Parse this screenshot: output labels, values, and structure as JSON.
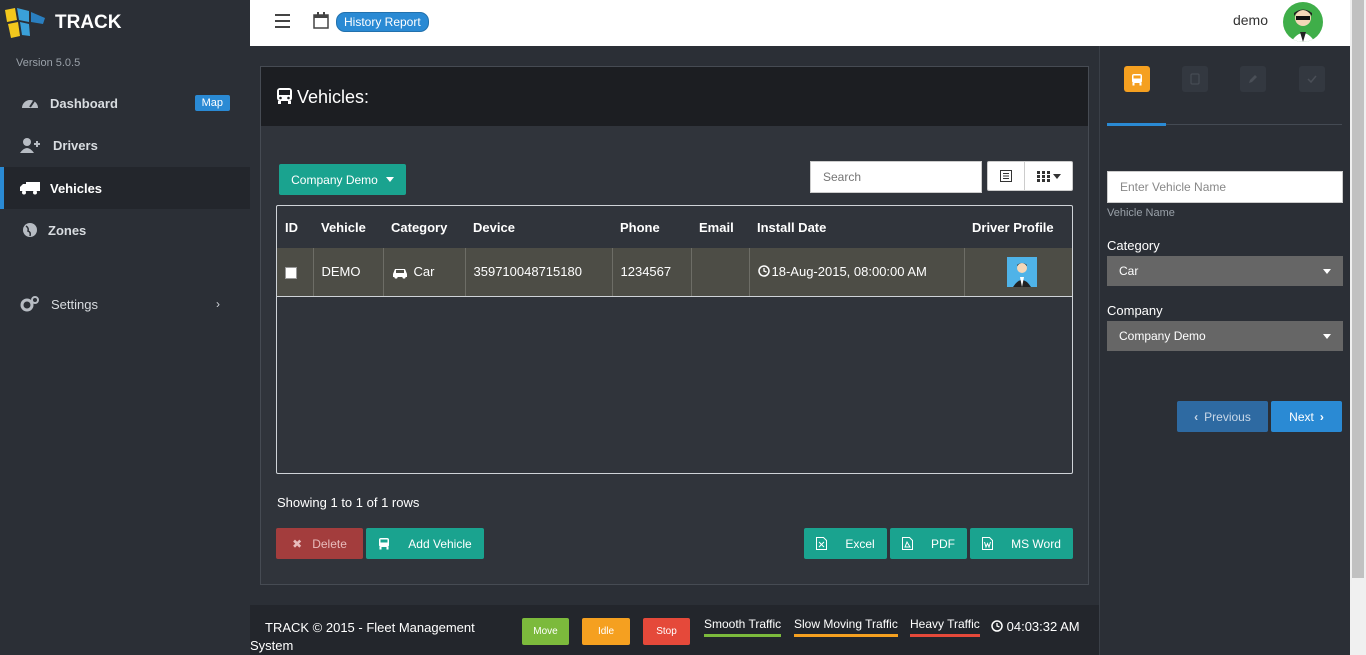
{
  "app": {
    "name": "TRACK",
    "version": "Version 5.0.5"
  },
  "sidebar": {
    "items": [
      {
        "label": "Dashboard",
        "icon": "dashboard-icon",
        "badge": "Map"
      },
      {
        "label": "Drivers",
        "icon": "add-user-icon"
      },
      {
        "label": "Vehicles",
        "icon": "truck-icon",
        "active": true
      },
      {
        "label": "Zones",
        "icon": "globe-icon"
      },
      {
        "label": "Settings",
        "icon": "gears-icon"
      }
    ]
  },
  "topbar": {
    "history_label": "History Report",
    "username": "demo"
  },
  "panel": {
    "title": "Vehicles:"
  },
  "toolbar": {
    "company_button": "Company Demo",
    "search_placeholder": "Search"
  },
  "table": {
    "headers": [
      "ID",
      "Vehicle",
      "Category",
      "Device",
      "Phone",
      "Email",
      "Install Date",
      "Driver Profile"
    ],
    "rows": [
      {
        "id": "",
        "vehicle": "DEMO",
        "category": "Car",
        "device": "359710048715180",
        "phone": "1234567",
        "email": "",
        "install_date": "18-Aug-2015, 08:00:00 AM"
      }
    ]
  },
  "pagination": {
    "showing": "Showing 1 to 1 of 1 rows"
  },
  "actions": {
    "delete": "Delete",
    "add": "Add Vehicle",
    "excel": "Excel",
    "pdf": "PDF",
    "word": "MS Word"
  },
  "footer": {
    "copyright": "TRACK © 2015 - Fleet Management System",
    "status": {
      "move": "Move",
      "idle": "Idle",
      "stop": "Stop"
    },
    "traffic": {
      "smooth": "Smooth Traffic",
      "slow": "Slow Moving Traffic",
      "heavy": "Heavy Traffic"
    },
    "time": "04:03:32 AM"
  },
  "rightpanel": {
    "vehicle_name_placeholder": "Enter Vehicle Name",
    "vehicle_name_help": "Vehicle Name",
    "category_label": "Category",
    "category_value": "Car",
    "company_label": "Company",
    "company_value": "Company Demo",
    "prev": "Previous",
    "next": "Next"
  },
  "colors": {
    "accent_teal": "#1aa38f",
    "accent_blue": "#2a8ad4",
    "idle_orange": "#f5a020",
    "stop_red": "#e5493a",
    "move_green": "#7cba3c"
  }
}
